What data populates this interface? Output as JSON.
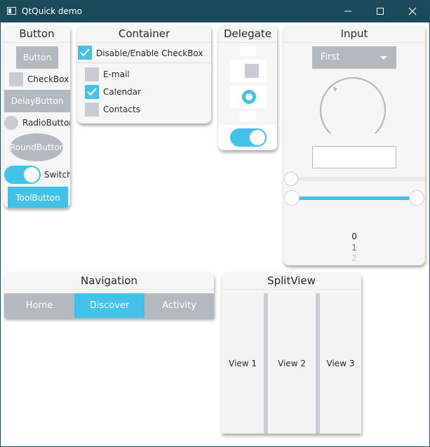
{
  "window": {
    "title": "QtQuick demo"
  },
  "buttons": {
    "title": "Button",
    "button": "Button",
    "checkbox": "CheckBox",
    "delay_button": "DelayButton",
    "radio_button": "RadioButton",
    "round_button": "RoundButton",
    "switch": "Switch",
    "tool_button": "ToolButton"
  },
  "container": {
    "title": "Container",
    "toggle_label": "Disable/Enable CheckBox",
    "items": [
      {
        "label": "E-mail",
        "checked": false
      },
      {
        "label": "Calendar",
        "checked": true
      },
      {
        "label": "Contacts",
        "checked": false
      }
    ]
  },
  "delegate": {
    "title": "Delegate"
  },
  "input": {
    "title": "Input",
    "combo_value": "First",
    "tumbler": [
      "0",
      "1",
      "2"
    ]
  },
  "navigation": {
    "title": "Navigation",
    "tabs": [
      "Home",
      "Discover",
      "Activity"
    ],
    "active_tab": "Discover"
  },
  "splitview": {
    "title": "SplitView",
    "views": [
      "View 1",
      "View 2",
      "View 3"
    ]
  },
  "colors": {
    "accent": "#42c1e9",
    "button": "#b4b8bf",
    "titlebar": "#1b4b5b"
  }
}
